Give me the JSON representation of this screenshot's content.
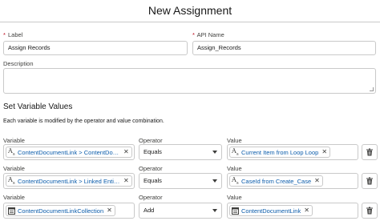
{
  "dialog": {
    "title": "New Assignment"
  },
  "fields": {
    "label": {
      "required_mark": "*",
      "label": "Label",
      "value": "Assign Records"
    },
    "api_name": {
      "required_mark": "*",
      "label": "API Name",
      "value": "Assign_Records"
    },
    "description": {
      "label": "Description",
      "value": ""
    }
  },
  "variables_section": {
    "title": "Set Variable Values",
    "description": "Each variable is modified by the operator and value combination.",
    "column_labels": {
      "variable": "Variable",
      "operator": "Operator",
      "value": "Value"
    },
    "rows": [
      {
        "variable": {
          "icon": "text-icon",
          "text": "ContentDocumentLink > ContentDoc…"
        },
        "operator": "Equals",
        "value": {
          "icon": "text-icon",
          "text": "Current Item from Loop Loop"
        }
      },
      {
        "variable": {
          "icon": "text-icon",
          "text": "ContentDocumentLink > Linked Entit…"
        },
        "operator": "Equals",
        "value": {
          "icon": "text-icon",
          "text": "CaseId from Create_Case"
        }
      },
      {
        "variable": {
          "icon": "collection-icon",
          "text": "ContentDocumentLinkCollection"
        },
        "operator": "Add",
        "value": {
          "icon": "collection-icon",
          "text": "ContentDocumentLink"
        }
      }
    ]
  },
  "icons": {
    "remove": "close-icon",
    "delete": "trash-icon",
    "dropdown": "chevron-down-icon"
  },
  "colors": {
    "link_text": "#0b5cab",
    "required": "#ba0517",
    "border": "#c9c9c9"
  }
}
